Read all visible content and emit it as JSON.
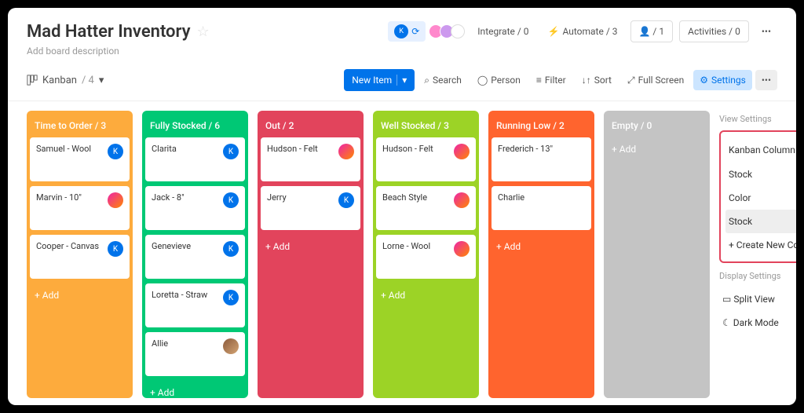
{
  "board": {
    "title": "Mad Hatter Inventory",
    "description_placeholder": "Add board description"
  },
  "header_buttons": {
    "integrate": "Integrate / 0",
    "automate": "Automate / 3",
    "members": "1",
    "activities": "Activities / 0"
  },
  "view": {
    "name": "Kanban",
    "count": "/ 4"
  },
  "toolbar": {
    "new_item": "New Item",
    "search": "Search",
    "person": "Person",
    "filter": "Filter",
    "sort": "Sort",
    "fullscreen": "Full Screen",
    "settings": "Settings"
  },
  "columns": [
    {
      "title": "Time to Order / 3",
      "color": "c-orange",
      "add": "+ Add",
      "cards": [
        {
          "title": "Samuel - Wool",
          "avatar": "k"
        },
        {
          "title": "Marvin - 10\"",
          "avatar": "img"
        },
        {
          "title": "Cooper - Canvas",
          "avatar": "k"
        }
      ]
    },
    {
      "title": "Fully Stocked / 6",
      "color": "c-green",
      "add": "+ Add",
      "cards": [
        {
          "title": "Clarita",
          "avatar": "k"
        },
        {
          "title": "Jack - 8\"",
          "avatar": "k"
        },
        {
          "title": "Genevieve",
          "avatar": "k"
        },
        {
          "title": "Loretta - Straw",
          "avatar": "k"
        },
        {
          "title": "Allie",
          "avatar": "img2"
        }
      ]
    },
    {
      "title": "Out / 2",
      "color": "c-red",
      "add": "+ Add",
      "cards": [
        {
          "title": "Hudson - Felt",
          "avatar": "img"
        },
        {
          "title": "Jerry",
          "avatar": "k"
        }
      ]
    },
    {
      "title": "Well Stocked / 3",
      "color": "c-lime",
      "add": "+ Add",
      "cards": [
        {
          "title": "Hudson - Felt",
          "avatar": "img"
        },
        {
          "title": "Beach Style",
          "avatar": "img"
        },
        {
          "title": "Lorne - Wool",
          "avatar": "img"
        }
      ]
    },
    {
      "title": "Running Low / 2",
      "color": "c-orange2",
      "add": "+ Add",
      "cards": [
        {
          "title": "Frederich - 13\"",
          "avatar": ""
        },
        {
          "title": "Charlie",
          "avatar": ""
        }
      ]
    },
    {
      "title": "Empty / 0",
      "color": "c-grey",
      "add": "+ Add",
      "cards": []
    }
  ],
  "settings_panel": {
    "view_settings": "View Settings",
    "kanban_column": "Kanban Column",
    "selected": "Stock",
    "options": [
      "Color",
      "Stock"
    ],
    "create": "+ Create New Column",
    "display_settings": "Display Settings",
    "split_view": "Split View",
    "dark_mode": "Dark Mode"
  }
}
